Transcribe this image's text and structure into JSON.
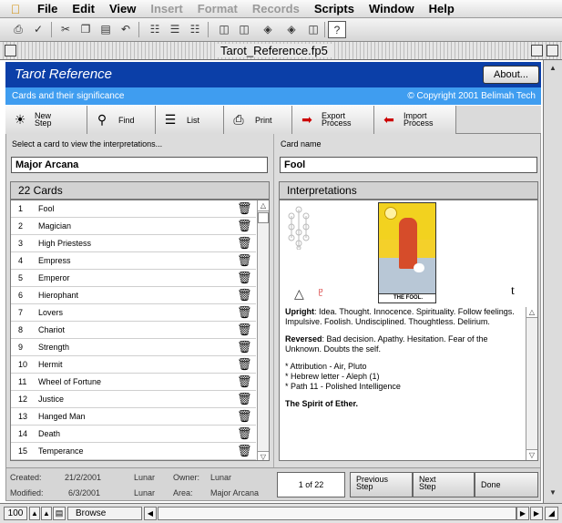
{
  "menu": {
    "apple_icon": "apple-icon",
    "items": [
      {
        "label": "File",
        "enabled": true
      },
      {
        "label": "Edit",
        "enabled": true
      },
      {
        "label": "View",
        "enabled": true
      },
      {
        "label": "Insert",
        "enabled": false
      },
      {
        "label": "Format",
        "enabled": false
      },
      {
        "label": "Records",
        "enabled": false
      },
      {
        "label": "Scripts",
        "enabled": true
      },
      {
        "label": "Window",
        "enabled": true
      },
      {
        "label": "Help",
        "enabled": true
      }
    ]
  },
  "window": {
    "title": "Tarot_Reference.fp5"
  },
  "header": {
    "title": "Tarot Reference",
    "about_label": "About...",
    "subtitle": "Cards and their significance",
    "copyright": "© Copyright 2001 Belimah Tech"
  },
  "nav": {
    "new_step": [
      "New",
      "Step"
    ],
    "find": "Find",
    "list": "List",
    "print": "Print",
    "export": [
      "Export",
      "Process"
    ],
    "import": [
      "Import",
      "Process"
    ]
  },
  "left": {
    "prompt": "Select a card to view the interpretations...",
    "category": "Major Arcana",
    "list_header": "22 Cards",
    "cards": [
      {
        "num": "1",
        "name": "Fool"
      },
      {
        "num": "2",
        "name": "Magician"
      },
      {
        "num": "3",
        "name": "High Priestess"
      },
      {
        "num": "4",
        "name": "Empress"
      },
      {
        "num": "5",
        "name": "Emperor"
      },
      {
        "num": "6",
        "name": "Hierophant"
      },
      {
        "num": "7",
        "name": "Lovers"
      },
      {
        "num": "8",
        "name": "Chariot"
      },
      {
        "num": "9",
        "name": "Strength"
      },
      {
        "num": "10",
        "name": "Hermit"
      },
      {
        "num": "11",
        "name": "Wheel of Fortune"
      },
      {
        "num": "12",
        "name": "Justice"
      },
      {
        "num": "13",
        "name": "Hanged Man"
      },
      {
        "num": "14",
        "name": "Death"
      },
      {
        "num": "15",
        "name": "Temperance"
      }
    ]
  },
  "right": {
    "card_name_label": "Card name",
    "card_name": "Fool",
    "interp_header": "Interpretations",
    "card_caption": "THE FOOL.",
    "symbols": {
      "triangle": "△",
      "pluto": "♇",
      "aleph": "t"
    },
    "upright_label": "Upright",
    "upright_text": ": Idea. Thought. Innocence. Spirituality. Follow feelings. Impulsive. Foolish. Undisciplined. Thoughtless. Delirium.",
    "reversed_label": "Reversed",
    "reversed_text": ": Bad decision. Apathy. Hesitation. Fear of the Unknown. Doubts the self.",
    "attributes": [
      "* Attribution - Air, Pluto",
      "* Hebrew letter - Aleph (1)",
      "* Path 11 - Polished Intelligence"
    ],
    "spirit": "The Spirit of Ether."
  },
  "footer": {
    "created_label": "Created:",
    "created_date": "21/2/2001",
    "created_by": "Lunar",
    "owner_label": "Owner:",
    "owner": "Lunar",
    "modified_label": "Modified:",
    "modified_date": "6/3/2001",
    "modified_by": "Lunar",
    "area_label": "Area:",
    "area": "Major Arcana",
    "pager": "1  of  22",
    "prev": [
      "Previous",
      "Step"
    ],
    "next": [
      "Next",
      "Step"
    ],
    "done": "Done"
  },
  "status": {
    "zoom": "100",
    "mode": "Browse"
  }
}
